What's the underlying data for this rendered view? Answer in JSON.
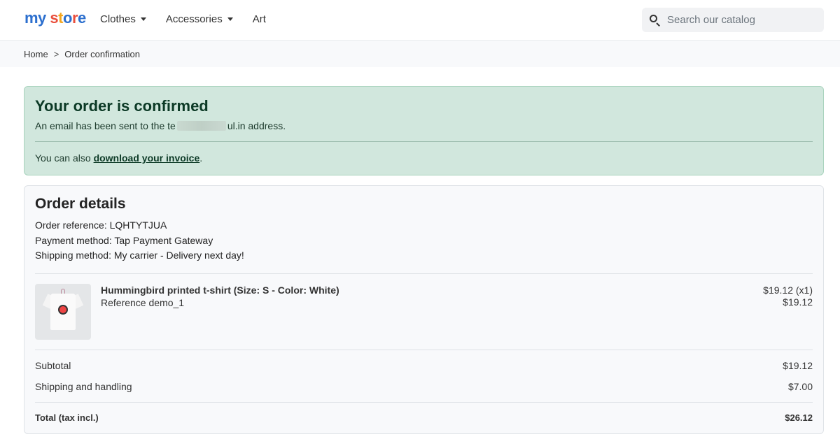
{
  "header": {
    "logo_my": "my",
    "logo_store": "store",
    "nav": [
      {
        "label": "Clothes",
        "has_dropdown": true
      },
      {
        "label": "Accessories",
        "has_dropdown": true
      },
      {
        "label": "Art",
        "has_dropdown": false
      }
    ],
    "search": {
      "placeholder": "Search our catalog",
      "icon": "search-icon"
    }
  },
  "breadcrumb": {
    "items": [
      "Home",
      "Order confirmation"
    ],
    "separator": ">"
  },
  "confirmation": {
    "title": "Your order is confirmed",
    "email_prefix": "An email has been sent to the te",
    "email_suffix": "ul.in address.",
    "invoice_prefix": "You can also ",
    "invoice_link": "download your invoice",
    "invoice_suffix": "."
  },
  "order_details": {
    "title": "Order details",
    "reference": "Order reference: LQHTYTJUA",
    "payment": "Payment method: Tap Payment Gateway",
    "shipping": "Shipping method: My carrier - Delivery next day!",
    "products": [
      {
        "name": "Hummingbird printed t-shirt (Size: S - Color: White)",
        "reference": "Reference demo_1",
        "unit_price": "$19.12 (x1)",
        "line_total": "$19.12"
      }
    ],
    "subtotal_label": "Subtotal",
    "subtotal_value": "$19.12",
    "shipping_label": "Shipping and handling",
    "shipping_value": "$7.00",
    "total_label": "Total (tax incl.)",
    "total_value": "$26.12"
  },
  "colors": {
    "success_bg": "#d1e7dd",
    "success_border": "#a8d3bd",
    "brand_blue": "#2c6fce"
  }
}
